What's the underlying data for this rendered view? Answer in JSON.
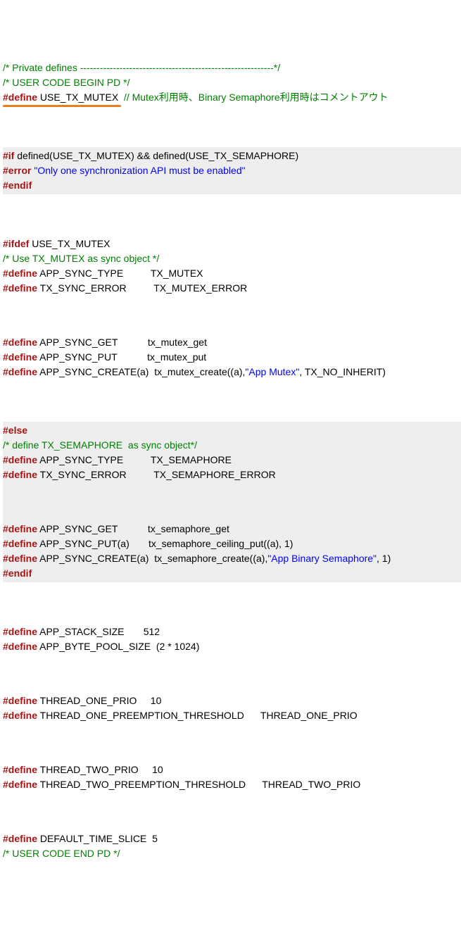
{
  "c1": "/* Private defines -----------------------------------------------------------*/",
  "c2": "/* USER CODE BEGIN PD */",
  "l3a": "#define",
  "l3b": " USE_TX_MUTEX ",
  "l3c": " // Mutex利用時、Binary Semaphore利用時はコメントアウト",
  "b1l1a": "#if",
  "b1l1b": " defined(USE_TX_MUTEX) && defined(USE_TX_SEMAPHORE)",
  "b1l2a": "#error",
  "b1l2b": " \"Only one synchronization API must be enabled\"",
  "b1l3": "#endif",
  "l4a": "#ifdef",
  "l4b": " USE_TX_MUTEX",
  "c3": "/* Use TX_MUTEX as sync object */",
  "l5a": "#define",
  "l5b": " APP_SYNC_TYPE          TX_MUTEX",
  "l6a": "#define",
  "l6b": " TX_SYNC_ERROR          TX_MUTEX_ERROR",
  "l7a": "#define",
  "l7b": " APP_SYNC_GET           tx_mutex_get",
  "l8a": "#define",
  "l8b": " APP_SYNC_PUT           tx_mutex_put",
  "l9a": "#define",
  "l9b": " APP_SYNC_CREATE(a)  tx_mutex_create((a),",
  "l9c": "\"App Mutex\"",
  "l9d": ", TX_NO_INHERIT)",
  "b2l1": "#else",
  "c4": "/* define TX_SEMAPHORE  as sync object*/",
  "l10a": "#define",
  "l10b": " APP_SYNC_TYPE          TX_SEMAPHORE",
  "l11a": "#define",
  "l11b": " TX_SYNC_ERROR          TX_SEMAPHORE_ERROR",
  "l12a": "#define",
  "l12b": " APP_SYNC_GET           tx_semaphore_get",
  "l13a": "#define",
  "l13b": " APP_SYNC_PUT(a)       tx_semaphore_ceiling_put((a), 1)",
  "l14a": "#define",
  "l14b": " APP_SYNC_CREATE(a)  tx_semaphore_create((a),",
  "l14c": "\"App Binary Semaphore\"",
  "l14d": ", 1)",
  "b2end": "#endif",
  "l15a": "#define",
  "l15b": " APP_STACK_SIZE       512",
  "l16a": "#define",
  "l16b": " APP_BYTE_POOL_SIZE  (2 * 1024)",
  "l17a": "#define",
  "l17b": " THREAD_ONE_PRIO     10",
  "l18a": "#define",
  "l18b": " THREAD_ONE_PREEMPTION_THRESHOLD      THREAD_ONE_PRIO",
  "l19a": "#define",
  "l19b": " THREAD_TWO_PRIO     10",
  "l20a": "#define",
  "l20b": " THREAD_TWO_PREEMPTION_THRESHOLD      THREAD_TWO_PRIO",
  "l21a": "#define",
  "l21b": " DEFAULT_TIME_SLICE  5",
  "cend": "/* USER CODE END PD */"
}
